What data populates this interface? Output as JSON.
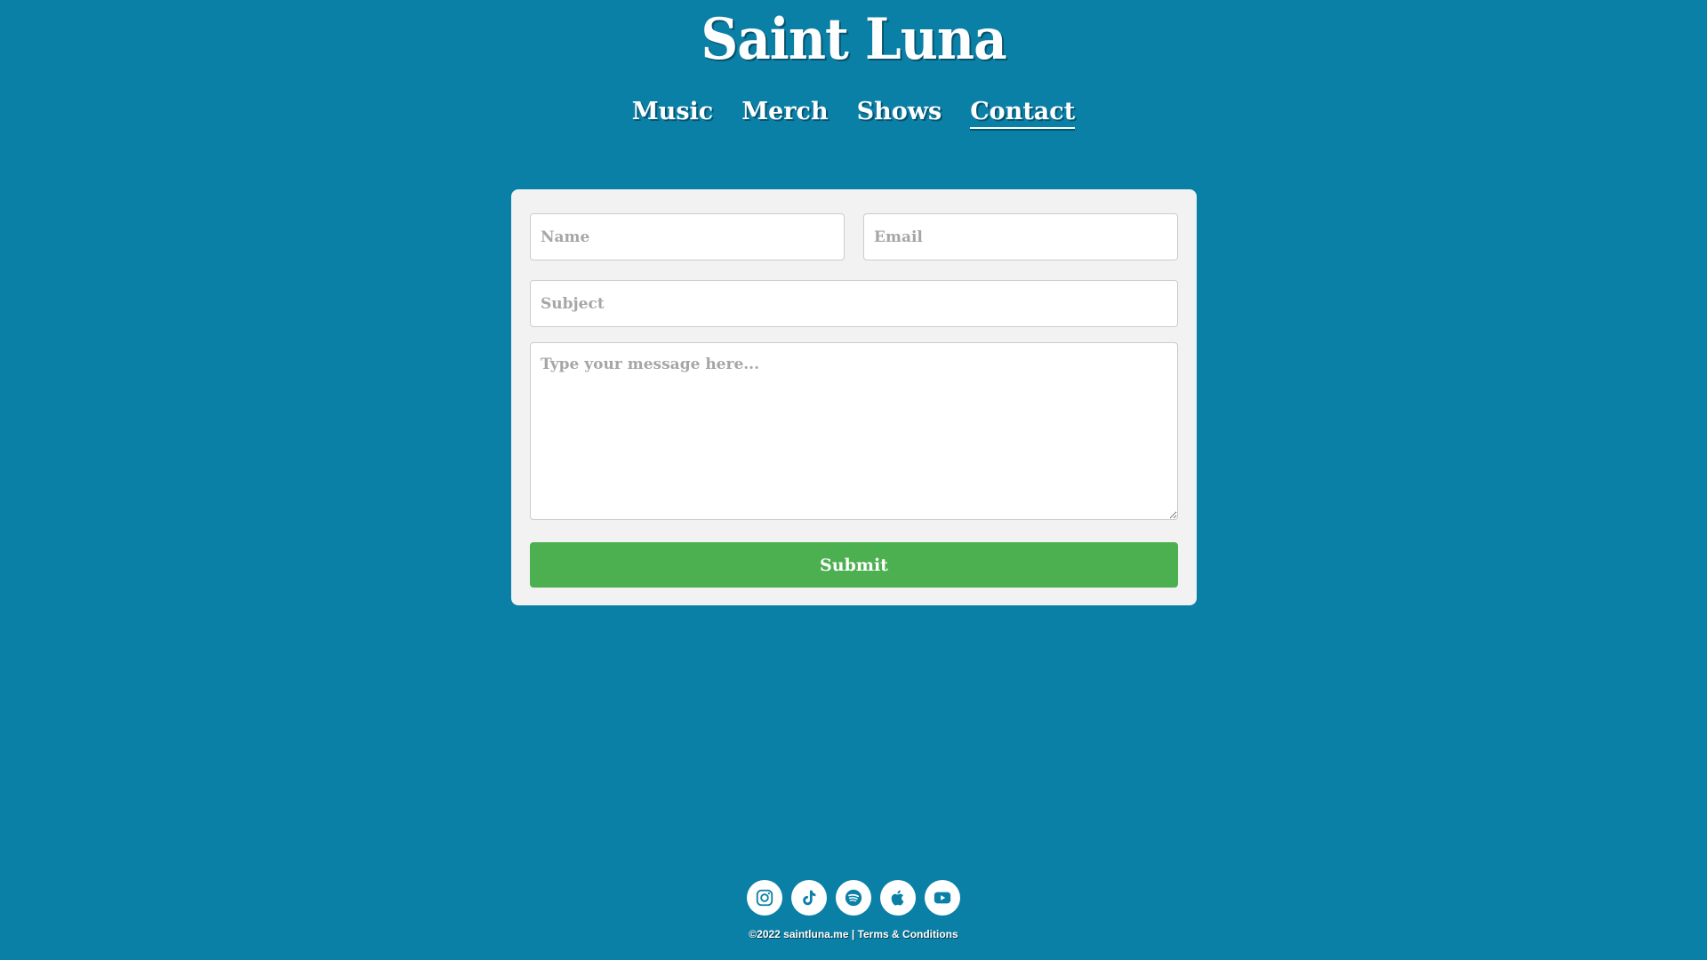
{
  "site": {
    "title": "Saint Luna"
  },
  "nav": {
    "items": [
      {
        "label": "Music"
      },
      {
        "label": "Merch"
      },
      {
        "label": "Shows"
      },
      {
        "label": "Contact",
        "active": true
      }
    ]
  },
  "form": {
    "name_placeholder": "Name",
    "email_placeholder": "Email",
    "subject_placeholder": "Subject",
    "message_placeholder": "Type your message here...",
    "submit_label": "Submit"
  },
  "socials": [
    {
      "icon": "instagram-icon"
    },
    {
      "icon": "tiktok-icon"
    },
    {
      "icon": "spotify-icon"
    },
    {
      "icon": "apple-icon"
    },
    {
      "icon": "youtube-icon"
    }
  ],
  "footer": {
    "copyright": "©2022 saintluna.me",
    "separator": " | ",
    "terms_label": "Terms & Conditions"
  },
  "colors": {
    "background": "#0b80a6",
    "card": "#f2f2f2",
    "submit": "#4caf50",
    "icon": "#0b80a6"
  }
}
